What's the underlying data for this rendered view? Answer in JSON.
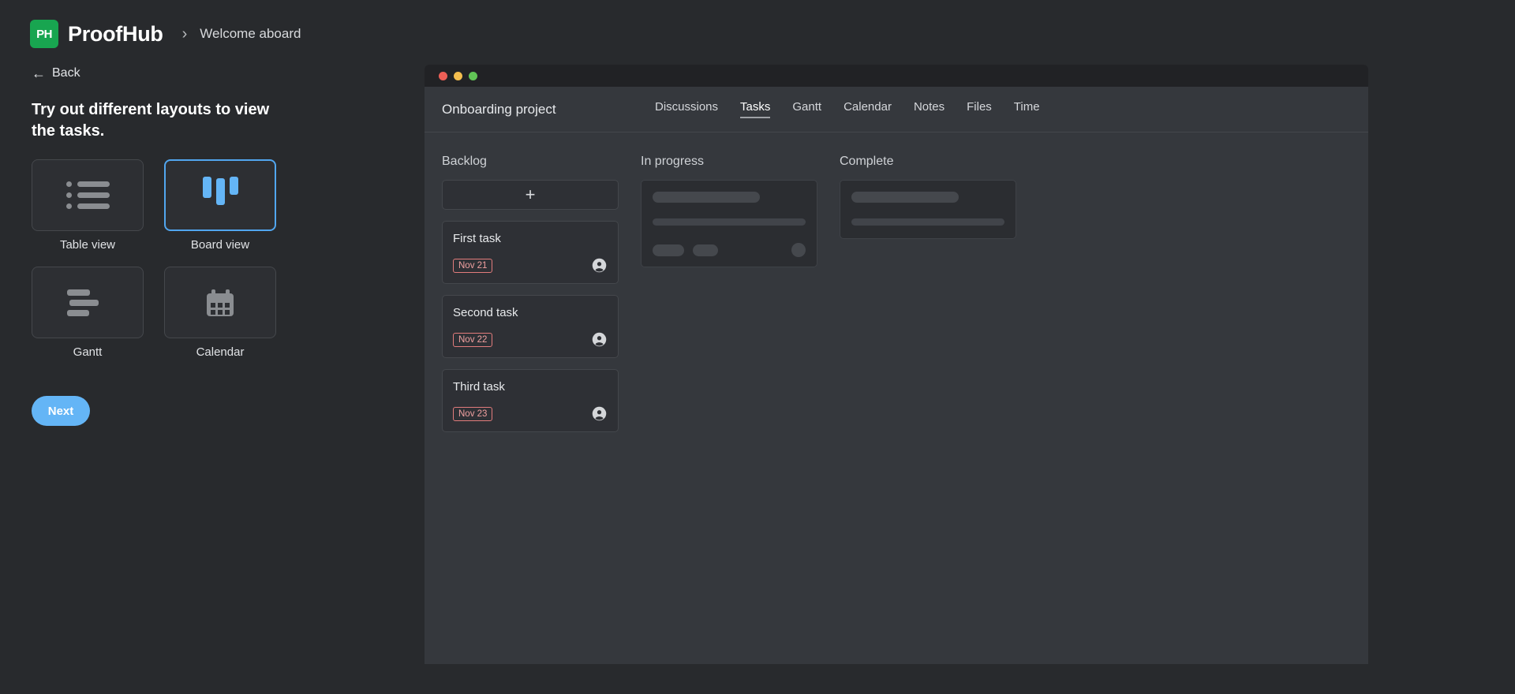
{
  "brand": {
    "logo_mark": "PH",
    "logo_text": "ProofHub",
    "breadcrumb_separator": "›",
    "breadcrumb_current": "Welcome aboard",
    "logo_color": "#18a550"
  },
  "left": {
    "back_label": "Back",
    "back_icon": "arrow-left-icon",
    "headline": "Try out different layouts to view the tasks.",
    "options": [
      {
        "label": "Table view",
        "icon": "list-icon",
        "selected": false
      },
      {
        "label": "Board view",
        "icon": "kanban-board-icon",
        "selected": true
      },
      {
        "label": "Gantt",
        "icon": "gantt-bars-icon",
        "selected": false
      },
      {
        "label": "Calendar",
        "icon": "calendar-icon",
        "selected": false
      }
    ],
    "next_label": "Next",
    "accent_color": "#64b5f6"
  },
  "mock": {
    "window_dots": [
      "red",
      "yellow",
      "green"
    ],
    "project_title": "Onboarding project",
    "tabs": [
      {
        "label": "Discussions",
        "active": false
      },
      {
        "label": "Tasks",
        "active": true
      },
      {
        "label": "Gantt",
        "active": false
      },
      {
        "label": "Calendar",
        "active": false
      },
      {
        "label": "Notes",
        "active": false
      },
      {
        "label": "Files",
        "active": false
      },
      {
        "label": "Time",
        "active": false
      }
    ],
    "columns": [
      {
        "title": "Backlog",
        "add_label": "+",
        "tasks": [
          {
            "name": "First task",
            "due": "Nov 21",
            "assignee_icon": "user-avatar-icon"
          },
          {
            "name": "Second task",
            "due": "Nov 22",
            "assignee_icon": "user-avatar-icon"
          },
          {
            "name": "Third task",
            "due": "Nov 23",
            "assignee_icon": "user-avatar-icon"
          }
        ],
        "skeletons": 0
      },
      {
        "title": "In progress",
        "tasks": [],
        "skeletons": 1,
        "skeleton_style": "full"
      },
      {
        "title": "Complete",
        "tasks": [],
        "skeletons": 1,
        "skeleton_style": "short"
      }
    ],
    "due_color": "#e27c7c"
  }
}
